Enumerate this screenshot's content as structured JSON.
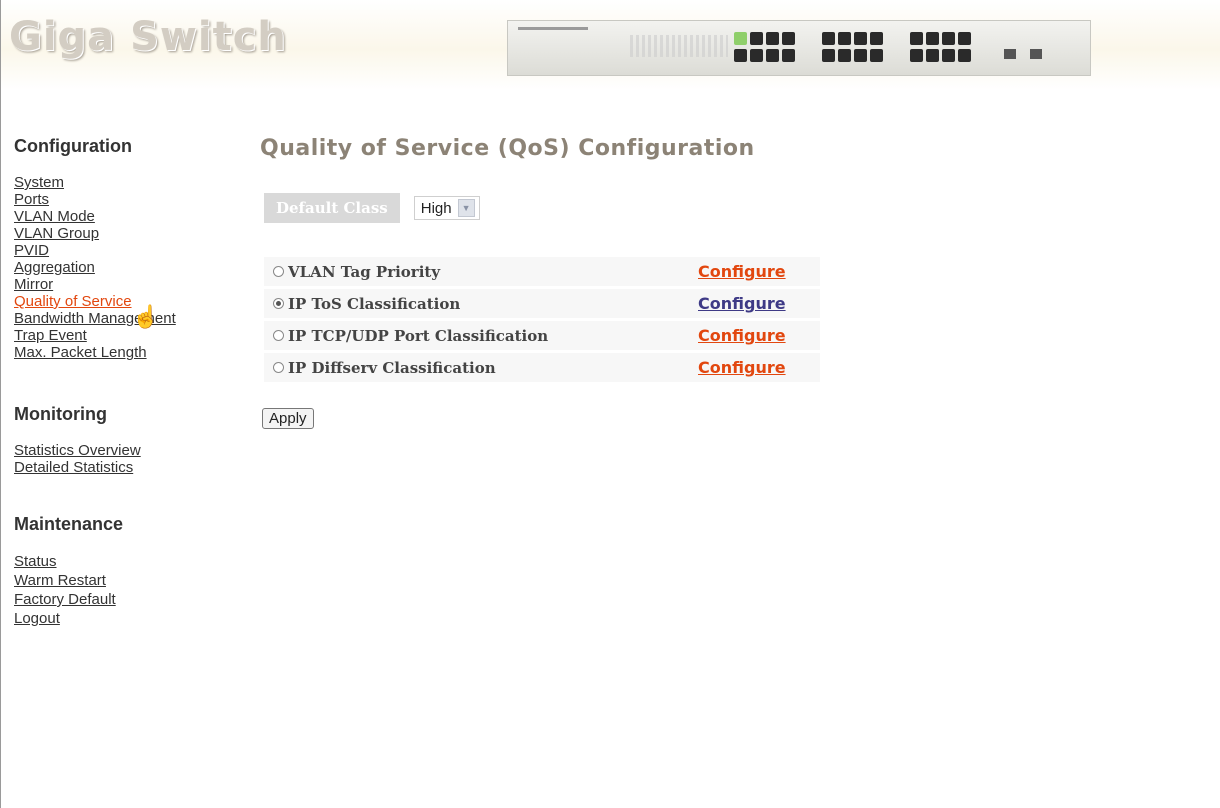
{
  "header": {
    "brand": "Giga Switch"
  },
  "sidebar": {
    "configuration": {
      "title": "Configuration",
      "items": [
        {
          "label": "System"
        },
        {
          "label": "Ports"
        },
        {
          "label": "VLAN Mode"
        },
        {
          "label": "VLAN Group"
        },
        {
          "label": "PVID"
        },
        {
          "label": "Aggregation"
        },
        {
          "label": "Mirror"
        },
        {
          "label": "Quality of Service",
          "active": true
        },
        {
          "label": "Bandwidth Management"
        },
        {
          "label": "Trap Event"
        },
        {
          "label": "Max. Packet Length"
        }
      ]
    },
    "monitoring": {
      "title": "Monitoring",
      "items": [
        {
          "label": "Statistics Overview"
        },
        {
          "label": "Detailed Statistics"
        }
      ]
    },
    "maintenance": {
      "title": "Maintenance",
      "items": [
        {
          "label": "Status"
        },
        {
          "label": "Warm Restart"
        },
        {
          "label": "Factory Default"
        },
        {
          "label": "Logout"
        }
      ]
    }
  },
  "main": {
    "title": "Quality of Service (QoS) Configuration",
    "default_class": {
      "label": "Default Class",
      "value": "High"
    },
    "options": [
      {
        "label": "VLAN Tag Priority",
        "selected": false,
        "link": "Configure"
      },
      {
        "label": "IP ToS Classification",
        "selected": true,
        "link": "Configure"
      },
      {
        "label": "IP TCP/UDP Port Classification",
        "selected": false,
        "link": "Configure"
      },
      {
        "label": "IP Diffserv Classification",
        "selected": false,
        "link": "Configure"
      }
    ],
    "apply_label": "Apply"
  },
  "colors": {
    "active_link": "#e2470f",
    "visited_link": "#3e3a86",
    "title": "#8c8376"
  }
}
